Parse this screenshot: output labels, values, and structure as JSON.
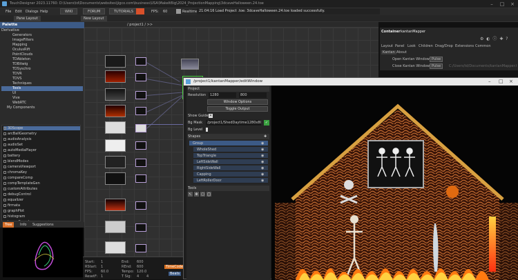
{
  "window": {
    "title": "TouchDesigner 2023.11760: D:\\Users\\td\\Documents\\websites\\jigco.com\\business\\USA\\MakeItBig\\2024_ProjectionMapping\\3dcaveHalloween.24.toe"
  },
  "menu": [
    "File",
    "Edit",
    "Dialogs",
    "Help"
  ],
  "toolbar": {
    "pane_layout": "Pane Layout",
    "new_layout": "New Layout",
    "wiki": "WIKI",
    "forum": "FORUM",
    "tutorials": "TUTORIALS",
    "fps_label": "FPS:",
    "fps": "60",
    "realtime": "Realtime",
    "status": "21:04:16 Load Project .toe: 3dcaveHalloween.24.toe loaded successfully.",
    "path": "/ project1 / >>"
  },
  "palette": {
    "title": "Palette",
    "tree": [
      "Derivative",
      "Generators",
      "ImageFilters",
      "Mapping",
      "OculusRift",
      "PointClouds",
      "TDAbleton",
      "TDBitwig",
      "TDSyschro",
      "TDVR",
      "TDVS",
      "Techniques",
      "Tools",
      "UI",
      "Vive",
      "WebRTC",
      "My Components"
    ],
    "ops": [
      "3DScope",
      "arcBallGeometry",
      "audioAnalysis",
      "audioSet",
      "autoMediaPlayer",
      "battery",
      "blendModes",
      "cameraViewport",
      "chromaKey",
      "compareComp",
      "compTemplateGen",
      "customAttributes",
      "debugControl",
      "equalizer",
      "firmata",
      "graphPlot",
      "histogram",
      "imageSearch"
    ],
    "tabs": [
      "Tree",
      "Info",
      "Suggestions"
    ]
  },
  "params": {
    "container_label": "Container",
    "container_name": "kantanMapper",
    "tabs": [
      "Layout",
      "Panel",
      "Look",
      "Children",
      "Drag/Drop",
      "Extensions",
      "Common"
    ],
    "subtabs": [
      "Kantan",
      "About"
    ],
    "open_label": "Open Kantan Window",
    "close_label": "Close Kantan Window",
    "pulse": "Pulse",
    "path_hint": "C:/Users/td/Documents/kantanMapper.tox"
  },
  "kantan": {
    "title": "/project1/kantanMapper/editWindow",
    "section": "Project",
    "res_label": "Resolution",
    "res_w": "1280",
    "res_h": "800",
    "window_options": "Window Options",
    "toggle_output": "Toggle Output",
    "show_guide": "Show Guide",
    "bg_mask_label": "Bg Mask",
    "bg_mask_value": "/project1/ShedDaytime1280x800",
    "bg_level_label": "Bg Level",
    "shapes_label": "Shapes",
    "shapes": [
      "Group",
      "WholeShed",
      "TopTriangle",
      "LeftSideWall",
      "RightSideWall",
      "Capping",
      "LeftRollerDoor"
    ],
    "tools_label": "Tools"
  },
  "timeline": {
    "start_label": "Start:",
    "start": "1",
    "end_label": "End:",
    "end": "600",
    "rstart_label": "RStart:",
    "rstart": "1",
    "rend_label": "REnd:",
    "rend": "600",
    "fps_label": "FPS:",
    "fps": "60.0",
    "tempo_label": "Tempo:",
    "tempo": "120.0",
    "reset_label": "ResetF:",
    "reset": "1",
    "tsig_label": "T Sig:",
    "tsig1": "4",
    "tsig2": "4",
    "timecode": "TimeCode",
    "beats": "Beats"
  },
  "colors": {
    "accent": "#3c5a86",
    "node_border": "#8a8a8a",
    "brick": "#b05a28",
    "fire": "#ff8a1a"
  }
}
